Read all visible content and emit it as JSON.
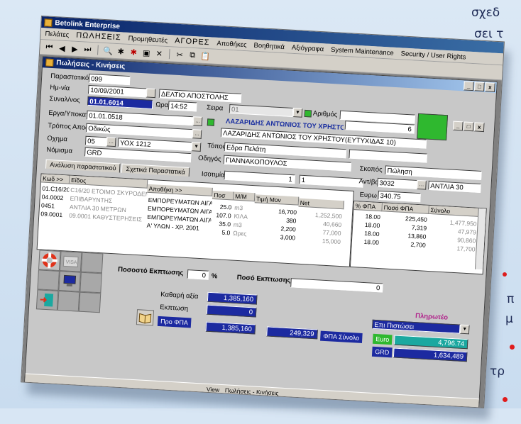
{
  "page": {
    "right_text_top": [
      "σχεδ",
      "σει τ"
    ],
    "right_text_bottom": [
      "π",
      "μ",
      "τρ"
    ]
  },
  "app": {
    "title": "Betolink Enterprise",
    "menu": [
      "Πελάτες",
      "ΠΩΛΗΣΕΙΣ",
      "Προμηθευτές",
      "ΑΓΟΡΕΣ",
      "Αποθήκες",
      "Βοηθητικά",
      "Αξιόγραφα",
      "System Maintenance",
      "Security / User Rights"
    ]
  },
  "child": {
    "title": "Πωλήσεις - Κινήσεις",
    "buttons": [
      "_",
      "□",
      "x"
    ]
  },
  "form": {
    "parastatiko_label": "Παραστατικό",
    "parastatiko_value": "099",
    "parastatiko_desc": "ΔΕΛΤΙΟ ΑΠΟΣΤΟΛΗΣ",
    "date_label": "Ημ-νία",
    "date_value": "10/09/2001",
    "time_label": "Ωρα",
    "time_value": "14:52",
    "seira_label": "Σειρα",
    "seira_value": "01",
    "arithmos_label": "Αριθμός",
    "arithmos_value": "6",
    "synal_label": "Συναλ/νος",
    "synal_value": "01.01.6014",
    "customer_name": "ΛΑΖΑΡΙΔΗΣ ΑΝΤΩΝΙΟΣ ΤΟΥ ΧΡΗΣΤΟΥ",
    "customer_full": "ΛΑΖΑΡΙΔΗΣ ΑΝΤΩΝΙΟΣ ΤΟΥ ΧΡΗΣΤΟΥ(ΕΥΤΥΧΙΔΑΣ 10)",
    "erga_label": "Εργα/Υποκατ",
    "erga_value": "01.01.0518",
    "tropos_label": "Τρόπος Αποστ",
    "tropos_value": "Οδικώς",
    "topos_label": "Τόπος",
    "topos_value": "Εδρα Πελάτη",
    "skopos_label": "Σκοπός",
    "skopos_value": "Πώληση",
    "oxima_label": "Οχημα",
    "oxima_code": "05",
    "oxima_plate": "ΥΟΧ 1212",
    "odigos_label": "Οδηγός",
    "odigos_value": "ΓΙΑΝΝΑΚΟΠΟΥΛΟΣ",
    "nomisma_label": "Νόμισμα",
    "nomisma_value": "GRD",
    "isotimia_label": "Ισοτιμία",
    "isotimia_value1": "1",
    "isotimia_value2": "1",
    "antitimo_label": "Αντ/βα",
    "antitimo_code": "3032",
    "antitimo_desc": "ΑΝΤΛΙΑ 30",
    "euro_label": "Ευρω",
    "euro_value": "340.75"
  },
  "tabs": [
    "Ανάλυση παραστατικού",
    "Σχετικά Παραστατικά"
  ],
  "grid": {
    "headers": [
      "Κωδ >>",
      "Είδος",
      "Αποθήκη >>",
      "Ποσ",
      "Μ/Μ",
      "Τιμή Μον",
      "Net",
      "% ΦΠΑ",
      "Ποσό ΦΠΑ",
      "Σύνολο"
    ],
    "rows": [
      {
        "kod": "01.C16/20",
        "eidos": "C16/20 ΕΤΟΙΜΟ ΣΚΥΡΟΔΕΜΑ",
        "apothiki": "ΕΜΠΟΡΕΥΜΑΤΩΝ ΑΙΓΑ",
        "pos": "25.0",
        "mm": "m3",
        "timi": "16,700",
        "net": "1,252,500",
        "fpa_pct": "18.00",
        "poso_fpa": "225,450",
        "synolo": "1,477,950"
      },
      {
        "kod": "04.0002",
        "eidos": "ΕΠΙΒΑΡΥΝΤΗΣ",
        "apothiki": "ΕΜΠΟΡΕΥΜΑΤΩΝ ΑΙΓΑ",
        "pos": "107.0",
        "mm": "ΚΙΛΑ",
        "timi": "380",
        "net": "40,660",
        "fpa_pct": "18.00",
        "poso_fpa": "7,319",
        "synolo": "47,979"
      },
      {
        "kod": "0451",
        "eidos": "ΑΝΤΛΙΑ 30 ΜΕΤΡΩΝ",
        "apothiki": "ΕΜΠΟΡΕΥΜΑΤΩΝ ΑΙΓΑ",
        "pos": "35.0",
        "mm": "m3",
        "timi": "2,200",
        "net": "77,000",
        "fpa_pct": "18.00",
        "poso_fpa": "13,860",
        "synolo": "90,860"
      },
      {
        "kod": "09.0001",
        "eidos": "09.0001 ΚΑΘΥΣΤΕΡΗΣΕΙΣ",
        "apothiki": "Α' ΥΛΩΝ - ΧΡ. 2001",
        "pos": "5.0",
        "mm": "Ωρες",
        "timi": "3,000",
        "net": "15,000",
        "fpa_pct": "18.00",
        "poso_fpa": "2,700",
        "synolo": "17,700"
      }
    ]
  },
  "discount": {
    "pct_label": "Ποσοστό Εκπτωσης",
    "pct_value": "0",
    "pct_sign": "%",
    "amount_label": "Ποσό Εκπτωσης",
    "amount_value": "0"
  },
  "totals": {
    "kathari_label": "Καθαρή αξία",
    "kathari_value": "1,385,160",
    "ekptosi_label": "Εκπτωση",
    "ekptosi_value": "0",
    "pro_fpa_label": "Προ ΦΠΑ",
    "pro_fpa_value": "1,385,160",
    "fpa_value": "249,329",
    "fpa_synolo_label": "ΦΠΑ Σύνολο",
    "plirotea_label": "Πληρωτέο",
    "payment_method": "Επι Πιστώσει",
    "euro_label": "Euro",
    "euro_value": "4,796.74",
    "grd_label": "GRD",
    "grd_value": "1,634,489"
  },
  "statusbar": {
    "view_label": "View",
    "view_value": "Πωλήσεις - Κινήσεις"
  },
  "colors": {
    "navy": "#1c2aa0",
    "green": "#2fb82f",
    "teal": "#1ba8a0",
    "bullet": "#e01b1b"
  }
}
